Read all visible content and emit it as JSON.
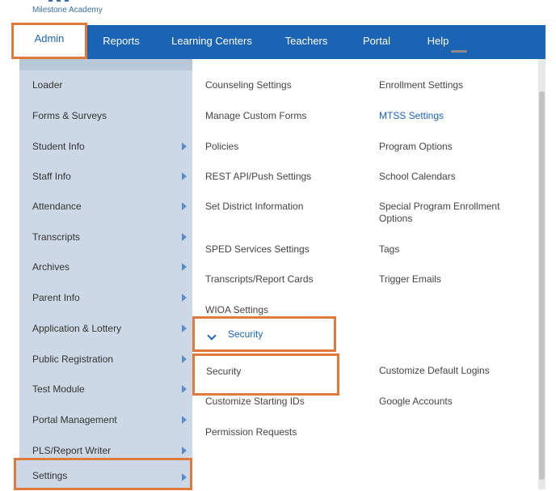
{
  "brand": {
    "name": "Milestone Academy",
    "accent": "#1b64b4",
    "highlight": "#e07a3a"
  },
  "nav": {
    "items": [
      "Admin",
      "Reports",
      "Learning Centers",
      "Teachers",
      "Portal",
      "Help"
    ],
    "active": "Admin"
  },
  "sidebar": {
    "items": [
      {
        "label": "Loader",
        "has_submenu": false
      },
      {
        "label": "Forms & Surveys",
        "has_submenu": false
      },
      {
        "label": "Student Info",
        "has_submenu": true
      },
      {
        "label": "Staff Info",
        "has_submenu": true
      },
      {
        "label": "Attendance",
        "has_submenu": true
      },
      {
        "label": "Transcripts",
        "has_submenu": true
      },
      {
        "label": "Archives",
        "has_submenu": true
      },
      {
        "label": "Parent Info",
        "has_submenu": true
      },
      {
        "label": "Application & Lottery",
        "has_submenu": true
      },
      {
        "label": "Public Registration",
        "has_submenu": true
      },
      {
        "label": "Test Module",
        "has_submenu": true
      },
      {
        "label": "Portal Management",
        "has_submenu": true
      },
      {
        "label": "PLS/Report Writer",
        "has_submenu": true
      },
      {
        "label": "Settings",
        "has_submenu": true
      }
    ],
    "selected": "Settings"
  },
  "settings_menu": {
    "col1": [
      "Counseling Settings",
      "Manage Custom Forms",
      "Policies",
      "REST API/Push Settings",
      "Set District Information",
      "SPED Services Settings",
      "Transcripts/Report Cards",
      "WIOA Settings"
    ],
    "col2": [
      "Enrollment Settings",
      "MTSS Settings",
      "Program Options",
      "School Calendars",
      "Special Program Enrollment Options",
      "Tags",
      "Trigger Emails"
    ],
    "security_header": "Security",
    "security_items": {
      "col1": [
        "Security",
        "Customize Starting IDs",
        "Permission Requests"
      ],
      "col2": [
        "Customize Default Logins",
        "Google Accounts"
      ]
    }
  }
}
